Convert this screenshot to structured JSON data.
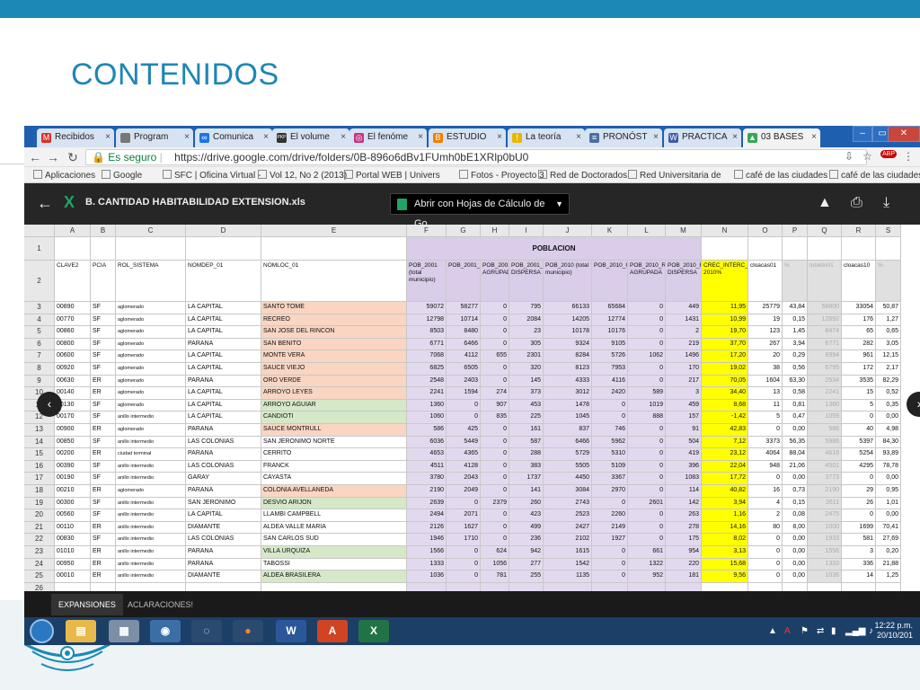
{
  "slide": {
    "title": "CONTENIDOS"
  },
  "tabs": [
    {
      "label": "Recibidos",
      "icon": "gmail-icon",
      "color": "#d93025",
      "glyph": "M"
    },
    {
      "label": "Program",
      "icon": "page-icon",
      "color": "#777777",
      "glyph": ""
    },
    {
      "label": "Comunica",
      "icon": "link-icon",
      "color": "#1a73e8",
      "glyph": "∞"
    },
    {
      "label": "El volume",
      "icon": "pkp-icon",
      "color": "#333333",
      "glyph": "PKP"
    },
    {
      "label": "El fenóme",
      "icon": "instagram-icon",
      "color": "#c13584",
      "glyph": "◎"
    },
    {
      "label": "ESTUDIO",
      "icon": "blogger-icon",
      "color": "#f57d00",
      "glyph": "B"
    },
    {
      "label": "La teoría",
      "icon": "warning-icon",
      "color": "#e6b800",
      "glyph": "!"
    },
    {
      "label": "PRONÓST",
      "icon": "doc-icon",
      "color": "#4a6fa5",
      "glyph": "≡"
    },
    {
      "label": "PRACTICA",
      "icon": "circle-icon",
      "color": "#3d5aa8",
      "glyph": "W"
    },
    {
      "label": "03 BASES",
      "icon": "drive-icon",
      "color": "#34a853",
      "glyph": "▲"
    }
  ],
  "address": {
    "secure": "Es seguro",
    "url": "https://drive.google.com/drive/folders/0B-896o6dBv1FUmh0bE1XRlp0bU0"
  },
  "bookmarks": [
    "Aplicaciones",
    "Google",
    "SFC | Oficina Virtual -",
    "Vol 12, No 2 (2013)",
    "Portal WEB | Univers",
    "Fotos - Proyecto 3",
    "Red de Doctorados",
    "Red Universitaria de",
    "café de las ciudades",
    "café de las ciudades"
  ],
  "viewer": {
    "file_title": "B. CANTIDAD HABITABILIDAD EXTENSION.xls",
    "open_with": "Abrir con Hojas de Cálculo de Go..."
  },
  "sheet": {
    "columns": [
      "A",
      "B",
      "C",
      "D",
      "E",
      "F",
      "G",
      "H",
      "I",
      "J",
      "K",
      "L",
      "M",
      "N",
      "O",
      "P",
      "Q",
      "R",
      "S"
    ],
    "poblacion_label": "POBLACION",
    "headers": [
      "CLAVE2",
      "PCIA",
      "ROL_SISTEMA",
      "NOMDEP_01",
      "NOMLOC_01",
      "POB_2001 (total municipio)",
      "POB_2001_U",
      "POB_2001_RURAL AGRUPADA",
      "POB_2001_RURAL DISPERSA",
      "POB_2010 (total municipio)",
      "POB_2010_U",
      "POB_2010_RURAL AGRUPADA",
      "POB_2010_RURAL DISPERSA",
      "CREC_INTERC_2001-2010%",
      "cloacas01",
      "%",
      "totaldo01",
      "cloacas10",
      "%"
    ],
    "rows": [
      {
        "n": "3",
        "c": [
          "00890",
          "SF",
          "aglomerado",
          "LA CAPITAL",
          "SANTO TOME",
          "59072",
          "58277",
          "0",
          "795",
          "66133",
          "65684",
          "0",
          "449",
          "11,95",
          "25779",
          "43,84",
          "58800",
          "33054",
          "50,87"
        ],
        "hl": "salmon"
      },
      {
        "n": "4",
        "c": [
          "00770",
          "SF",
          "aglomerado",
          "LA CAPITAL",
          "RECREO",
          "12798",
          "10714",
          "0",
          "2084",
          "14205",
          "12774",
          "0",
          "1431",
          "10,99",
          "19",
          "0,15",
          "12692",
          "176",
          "1,27"
        ],
        "hl": "salmon"
      },
      {
        "n": "5",
        "c": [
          "00860",
          "SF",
          "aglomerado",
          "LA CAPITAL",
          "SAN JOSE DEL RINCON",
          "8503",
          "8480",
          "0",
          "23",
          "10178",
          "10176",
          "0",
          "2",
          "19,70",
          "123",
          "1,45",
          "8474",
          "65",
          "0,65"
        ],
        "hl": "salmon"
      },
      {
        "n": "6",
        "c": [
          "00800",
          "SF",
          "aglomerado",
          "PARANA",
          "SAN BENITO",
          "6771",
          "6466",
          "0",
          "305",
          "9324",
          "9105",
          "0",
          "219",
          "37,70",
          "267",
          "3,94",
          "6771",
          "282",
          "3,05"
        ],
        "hl": "salmon"
      },
      {
        "n": "7",
        "c": [
          "00600",
          "SF",
          "aglomerado",
          "LA CAPITAL",
          "MONTE VERA",
          "7068",
          "4112",
          "655",
          "2301",
          "8284",
          "5726",
          "1062",
          "1496",
          "17,20",
          "20",
          "0,29",
          "6994",
          "961",
          "12,15"
        ],
        "hl": "salmon"
      },
      {
        "n": "8",
        "c": [
          "00920",
          "SF",
          "aglomerado",
          "LA CAPITAL",
          "SAUCE VIEJO",
          "6825",
          "6505",
          "0",
          "320",
          "8123",
          "7953",
          "0",
          "170",
          "19,02",
          "38",
          "0,56",
          "6795",
          "172",
          "2,17"
        ],
        "hl": "salmon"
      },
      {
        "n": "9",
        "c": [
          "00630",
          "ER",
          "aglomerado",
          "PARANA",
          "ORO VERDE",
          "2548",
          "2403",
          "0",
          "145",
          "4333",
          "4116",
          "0",
          "217",
          "70,05",
          "1604",
          "63,30",
          "2534",
          "3535",
          "82,29"
        ],
        "hl": "salmon"
      },
      {
        "n": "10",
        "c": [
          "00140",
          "ER",
          "aglomerado",
          "LA CAPITAL",
          "ARROYO LEYES",
          "2241",
          "1594",
          "274",
          "373",
          "3012",
          "2420",
          "589",
          "3",
          "34,40",
          "13",
          "0,58",
          "2241",
          "15",
          "0,52"
        ],
        "hl": "salmon"
      },
      {
        "n": "11",
        "c": [
          "00130",
          "SF",
          "aglomerado",
          "LA CAPITAL",
          "ARROYO AGUIAR",
          "1360",
          "0",
          "907",
          "453",
          "1478",
          "0",
          "1019",
          "459",
          "8,68",
          "11",
          "0,81",
          "1360",
          "5",
          "0,35"
        ],
        "hl": "green"
      },
      {
        "n": "12",
        "c": [
          "00170",
          "SF",
          "anillo intermedio",
          "LA CAPITAL",
          "CANDIOTI",
          "1060",
          "0",
          "835",
          "225",
          "1045",
          "0",
          "888",
          "157",
          "-1,42",
          "5",
          "0,47",
          "1059",
          "0",
          "0,00"
        ],
        "hl": "green"
      },
      {
        "n": "13",
        "c": [
          "00900",
          "ER",
          "aglomerado",
          "PARANA",
          "SAUCE MONTRULL",
          "586",
          "425",
          "0",
          "161",
          "837",
          "746",
          "0",
          "91",
          "42,83",
          "0",
          "0,00",
          "586",
          "40",
          "4,98"
        ],
        "hl": "salmon"
      },
      {
        "n": "14",
        "c": [
          "00850",
          "SF",
          "anillo intermedio",
          "LAS COLONIAS",
          "SAN JERONIMO NORTE",
          "6036",
          "5449",
          "0",
          "587",
          "6466",
          "5962",
          "0",
          "504",
          "7,12",
          "3373",
          "56,35",
          "5986",
          "5397",
          "84,30"
        ],
        "hl": "none"
      },
      {
        "n": "15",
        "c": [
          "00200",
          "ER",
          "ciudad terminal",
          "PARANA",
          "CERRITO",
          "4653",
          "4365",
          "0",
          "288",
          "5729",
          "5310",
          "0",
          "419",
          "23,12",
          "4064",
          "88,04",
          "4616",
          "5254",
          "93,89"
        ],
        "hl": "none"
      },
      {
        "n": "16",
        "c": [
          "00390",
          "SF",
          "anillo intermedio",
          "LAS COLONIAS",
          "FRANCK",
          "4511",
          "4128",
          "0",
          "383",
          "5505",
          "5109",
          "0",
          "396",
          "22,04",
          "948",
          "21,06",
          "4501",
          "4295",
          "78,78"
        ],
        "hl": "none"
      },
      {
        "n": "17",
        "c": [
          "00190",
          "SF",
          "anillo intermedio",
          "GARAY",
          "CAYASTA",
          "3780",
          "2043",
          "0",
          "1737",
          "4450",
          "3367",
          "0",
          "1083",
          "17,72",
          "0",
          "0,00",
          "3773",
          "0",
          "0,00"
        ],
        "hl": "none"
      },
      {
        "n": "18",
        "c": [
          "00210",
          "ER",
          "aglomerado",
          "PARANA",
          "COLONIA AVELLANEDA",
          "2190",
          "2049",
          "0",
          "141",
          "3084",
          "2970",
          "0",
          "114",
          "40,82",
          "16",
          "0,73",
          "2190",
          "29",
          "0,95"
        ],
        "hl": "salmon"
      },
      {
        "n": "19",
        "c": [
          "00300",
          "SF",
          "anillo intermedio",
          "SAN JERONIMO",
          "DESVIO ARIJON",
          "2639",
          "0",
          "2379",
          "260",
          "2743",
          "0",
          "2601",
          "142",
          "3,94",
          "4",
          "0,15",
          "2611",
          "26",
          "1,01"
        ],
        "hl": "green"
      },
      {
        "n": "20",
        "c": [
          "00560",
          "SF",
          "anillo intermedio",
          "LA CAPITAL",
          "LLAMBI CAMPBELL",
          "2494",
          "2071",
          "0",
          "423",
          "2523",
          "2260",
          "0",
          "263",
          "1,16",
          "2",
          "0,08",
          "2475",
          "0",
          "0,00"
        ],
        "hl": "none"
      },
      {
        "n": "21",
        "c": [
          "00110",
          "ER",
          "anillo intermedio",
          "DIAMANTE",
          "ALDEA VALLE MARIA",
          "2126",
          "1627",
          "0",
          "499",
          "2427",
          "2149",
          "0",
          "278",
          "14,16",
          "80",
          "8,00",
          "1000",
          "1699",
          "70,41"
        ],
        "hl": "none"
      },
      {
        "n": "22",
        "c": [
          "00830",
          "SF",
          "anillo intermedio",
          "LAS COLONIAS",
          "SAN CARLOS SUD",
          "1946",
          "1710",
          "0",
          "236",
          "2102",
          "1927",
          "0",
          "175",
          "8,02",
          "0",
          "0,00",
          "1933",
          "581",
          "27,69"
        ],
        "hl": "none"
      },
      {
        "n": "23",
        "c": [
          "01010",
          "ER",
          "anillo intermedio",
          "PARANA",
          "VILLA URQUIZA",
          "1566",
          "0",
          "624",
          "942",
          "1615",
          "0",
          "661",
          "954",
          "3,13",
          "0",
          "0,00",
          "1556",
          "3",
          "0,20"
        ],
        "hl": "green"
      },
      {
        "n": "24",
        "c": [
          "00950",
          "ER",
          "anillo intermedio",
          "PARANA",
          "TABOSSI",
          "1333",
          "0",
          "1056",
          "277",
          "1542",
          "0",
          "1322",
          "220",
          "15,68",
          "0",
          "0,00",
          "1333",
          "336",
          "21,88"
        ],
        "hl": "none"
      },
      {
        "n": "25",
        "c": [
          "00010",
          "ER",
          "anillo intermedio",
          "DIAMANTE",
          "ALDEA BRASILERA",
          "1036",
          "0",
          "781",
          "255",
          "1135",
          "0",
          "952",
          "181",
          "9,56",
          "0",
          "0,00",
          "1036",
          "14",
          "1,25"
        ],
        "hl": "green"
      },
      {
        "n": "26",
        "c": [
          "",
          "",
          "",
          "",
          "",
          "",
          "",
          "",
          "",
          "",
          "",
          "",
          "",
          "",
          "",
          "",
          "",
          "",
          ""
        ],
        "hl": "none"
      }
    ]
  },
  "sheet_tabs": [
    "EXPANSIONES",
    "ACLARACIONES!"
  ],
  "taskbar": {
    "time": "12:22 p.m.",
    "date": "20/10/201"
  },
  "colors": {
    "slide_accent": "#1f86b5",
    "highlight_salmon": "#f9d5c2",
    "highlight_green": "#d5e8c8",
    "growth_yellow": "#ffff00"
  }
}
